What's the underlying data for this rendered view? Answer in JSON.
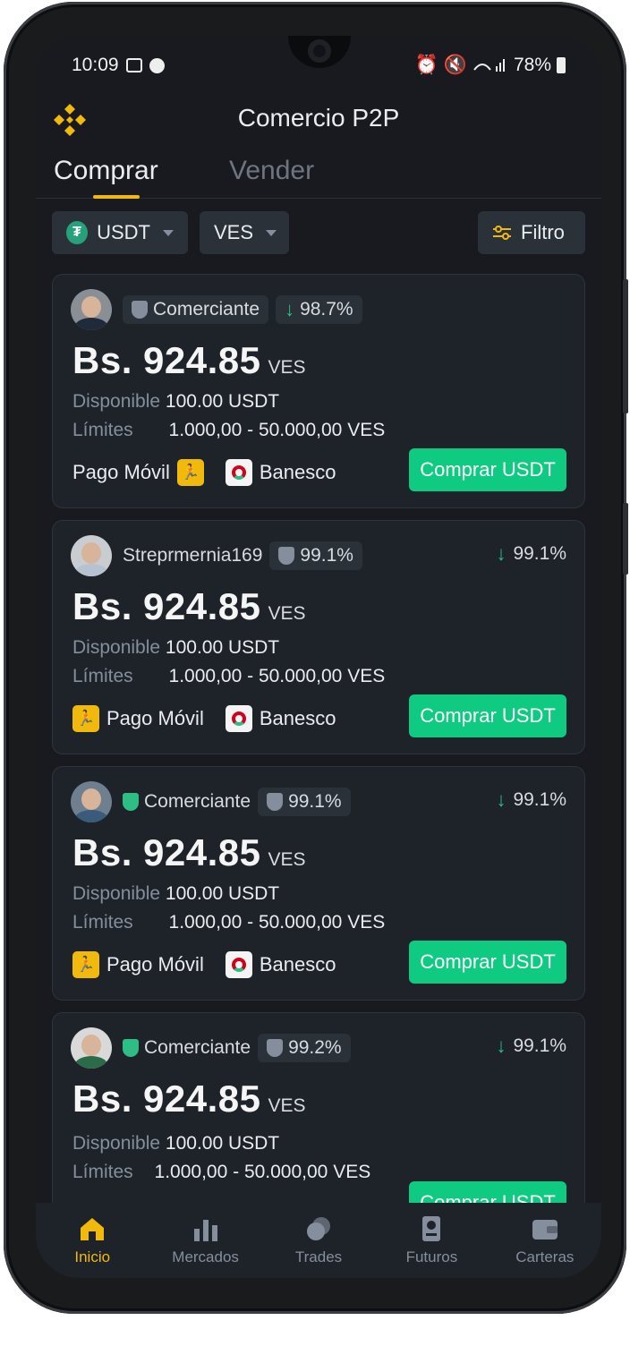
{
  "status_bar": {
    "time": "10:09",
    "battery": "78%"
  },
  "header": {
    "title": "Comercio P2P"
  },
  "tabs": [
    {
      "label": "Comprar"
    },
    {
      "label": "Vender"
    }
  ],
  "filters": {
    "asset": "USDT",
    "fiat": "VES",
    "filter_label": "Filtro"
  },
  "colors": {
    "accent": "#f0b90b",
    "buy": "#0ecb81",
    "background": "#181a20",
    "card": "#1e2329"
  },
  "offers": [
    {
      "name": "Comerciante",
      "badge_pct": "98.7%",
      "right_pct": "",
      "price": "Bs. 924.85",
      "currency": "VES",
      "available_label": "Disponible",
      "available": "100.00 USDT",
      "limits_label": "Límites",
      "limits": "1.000,00 - 50.000,00 VES",
      "pay1": "Pago Móvil",
      "pay2": "Banesco",
      "button": "Comprar USDT"
    },
    {
      "name": "Streprmernia169",
      "badge_pct": "99.1%",
      "right_pct": "99.1%",
      "price": "Bs. 924.85",
      "currency": "VES",
      "available_label": "Disponible",
      "available": "100.00 USDT",
      "limits_label": "Límites",
      "limits": "1.000,00 - 50.000,00 VES",
      "pay1": "Pago Móvil",
      "pay2": "Banesco",
      "button": "Comprar USDT"
    },
    {
      "name": "Comerciante",
      "badge_pct": "99.1%",
      "right_pct": "99.1%",
      "price": "Bs. 924.85",
      "currency": "VES",
      "available_label": "Disponible",
      "available": "100.00 USDT",
      "limits_label": "Límites",
      "limits": "1.000,00 - 50.000,00 VES",
      "pay1": "Pago Móvil",
      "pay2": "Banesco",
      "button": "Comprar USDT"
    },
    {
      "name": "Comerciante",
      "badge_pct": "99.2%",
      "right_pct": "99.1%",
      "price": "Bs. 924.85",
      "currency": "VES",
      "available_label": "Disponible",
      "available": "100.00 USDT",
      "limits_label": "Límites",
      "limits": "1.000,00 - 50.000,00 VES",
      "pay1": "",
      "pay2": "",
      "button": "Comprar USDT"
    }
  ],
  "nav": [
    {
      "label": "Inicio",
      "icon": "home-icon"
    },
    {
      "label": "Mercados",
      "icon": "bar-chart-icon"
    },
    {
      "label": "Trades",
      "icon": "coins-icon"
    },
    {
      "label": "Futuros",
      "icon": "contract-icon"
    },
    {
      "label": "Carteras",
      "icon": "wallet-icon"
    }
  ]
}
